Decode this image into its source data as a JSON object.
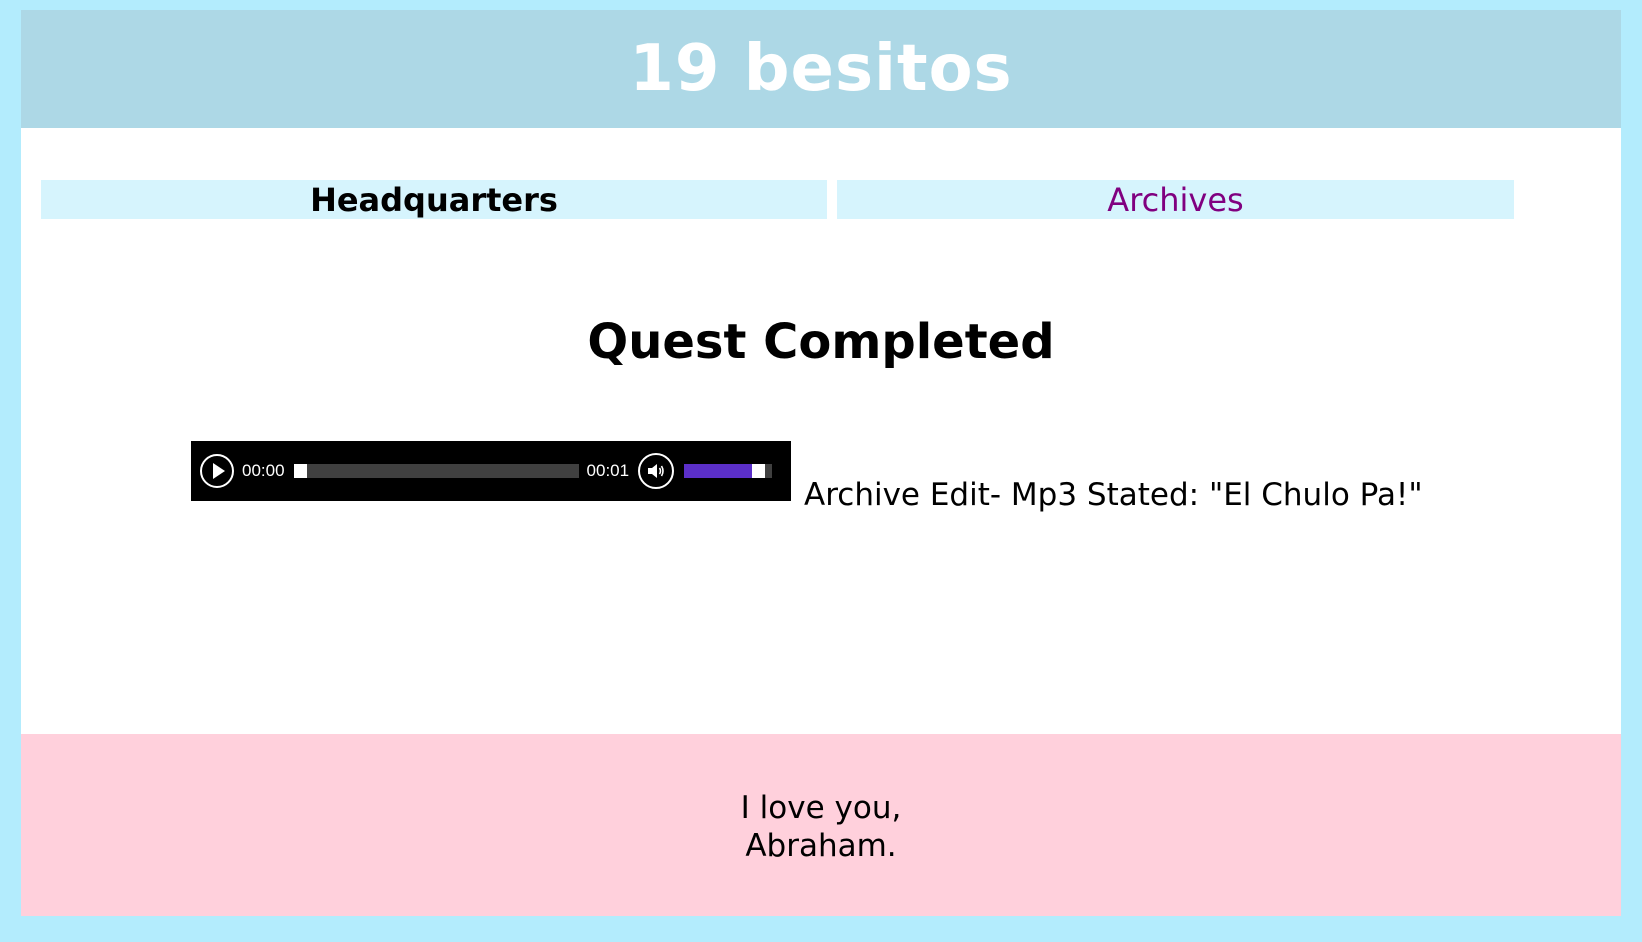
{
  "header": {
    "title": "19 besitos"
  },
  "nav": {
    "items": [
      {
        "label": "Headquarters"
      },
      {
        "label": "Archives"
      }
    ]
  },
  "main": {
    "heading": "Quest Completed",
    "audio": {
      "current_time": "00:00",
      "duration": "00:01",
      "progress": 0,
      "volume": 0.9,
      "accent_color": "#5b2fc9"
    },
    "caption": "Archive Edit- Mp3 Stated: \"El Chulo Pa!\""
  },
  "footer": {
    "line1": "I love you,",
    "line2": "Abraham."
  },
  "colors": {
    "page_background": "#b3ecfd",
    "header_background": "#add8e6",
    "nav_background": "#d6f4fd",
    "footer_background": "#ffd0dc",
    "visited_link": "#800080"
  }
}
